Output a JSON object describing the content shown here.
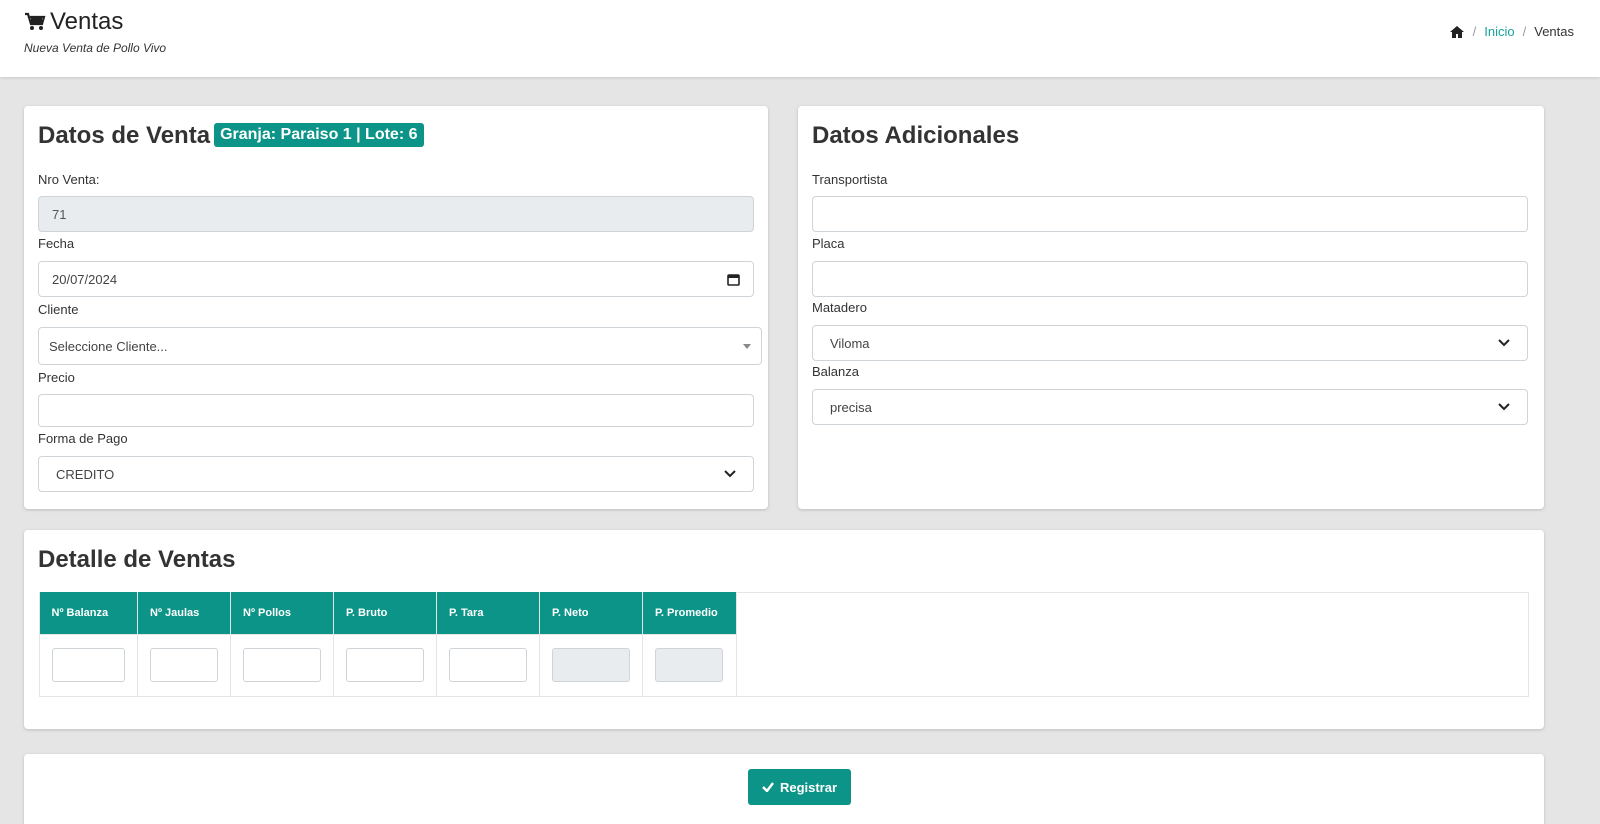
{
  "header": {
    "title": "Ventas",
    "subtitle": "Nueva Venta de Pollo Vivo",
    "breadcrumb": {
      "home_icon": "home-icon",
      "inicio": "Inicio",
      "current": "Ventas",
      "sep": "/"
    }
  },
  "datos_venta": {
    "title": "Datos de Venta",
    "badge": "Granja: Paraiso 1 | Lote: 6",
    "nro_venta_label": "Nro Venta:",
    "nro_venta_value": "71",
    "fecha_label": "Fecha",
    "fecha_value": "20/07/2024",
    "cliente_label": "Cliente",
    "cliente_placeholder": "Seleccione Cliente...",
    "precio_label": "Precio",
    "precio_value": "",
    "forma_pago_label": "Forma de Pago",
    "forma_pago_value": "CREDITO"
  },
  "datos_adicionales": {
    "title": "Datos Adicionales",
    "transportista_label": "Transportista",
    "transportista_value": "",
    "placa_label": "Placa",
    "placa_value": "",
    "matadero_label": "Matadero",
    "matadero_value": "Viloma",
    "balanza_label": "Balanza",
    "balanza_value": "precisa"
  },
  "detalle": {
    "title": "Detalle de Ventas",
    "columns": [
      "Nº Balanza",
      "Nº Jaulas",
      "Nº Pollos",
      "P. Bruto",
      "P. Tara",
      "P. Neto",
      "P. Promedio"
    ]
  },
  "actions": {
    "register_label": "Registrar"
  },
  "colors": {
    "accent": "#0d9488",
    "link": "#17a2a0",
    "background": "#e5e5e5"
  }
}
